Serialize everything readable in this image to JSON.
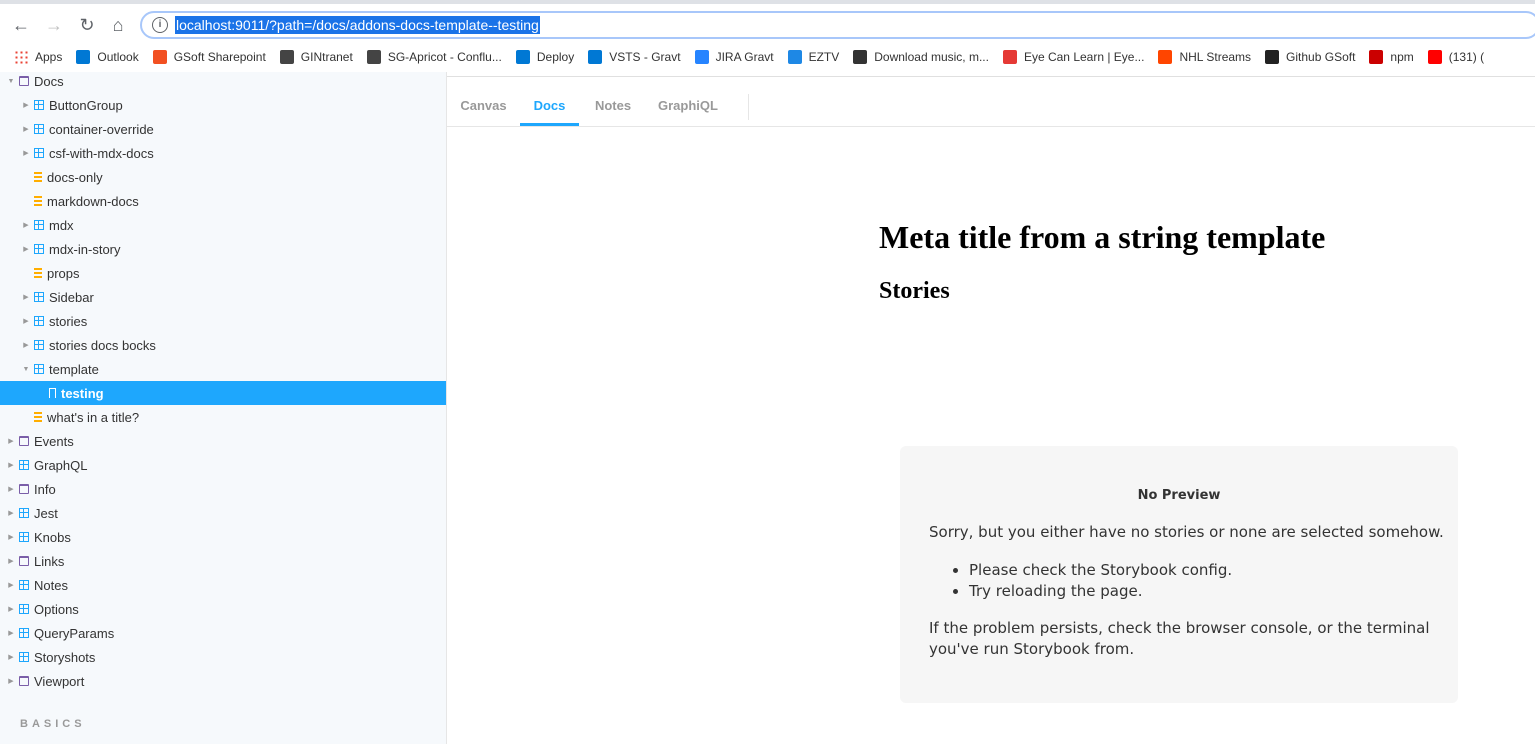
{
  "browser": {
    "url": "localhost:9011/?path=/docs/addons-docs-template--testing",
    "bookmarks": [
      {
        "label": "Apps",
        "icon": "apps-grid-icon",
        "color": "#ea4335"
      },
      {
        "label": "Outlook",
        "icon": "outlook-icon",
        "color": "#0078d4"
      },
      {
        "label": "GSoft Sharepoint",
        "icon": "windows-icon",
        "color": "#f25022"
      },
      {
        "label": "GINtranet",
        "icon": "g-icon",
        "color": "#444444"
      },
      {
        "label": "SG-Apricot - Conflu...",
        "icon": "g-icon",
        "color": "#444444"
      },
      {
        "label": "Deploy",
        "icon": "vsts-icon",
        "color": "#0078d4"
      },
      {
        "label": "VSTS - Gravt",
        "icon": "vsts-icon",
        "color": "#0078d4"
      },
      {
        "label": "JIRA Gravt",
        "icon": "jira-icon",
        "color": "#2684ff"
      },
      {
        "label": "EZTV",
        "icon": "eztv-icon",
        "color": "#1e88e5"
      },
      {
        "label": "Download music, m...",
        "icon": "download-icon",
        "color": "#333333"
      },
      {
        "label": "Eye Can Learn | Eye...",
        "icon": "ladybug-icon",
        "color": "#e53935"
      },
      {
        "label": "NHL Streams",
        "icon": "reddit-icon",
        "color": "#ff4500"
      },
      {
        "label": "Github GSoft",
        "icon": "github-icon",
        "color": "#222222"
      },
      {
        "label": "npm",
        "icon": "npm-icon",
        "color": "#cb0000"
      },
      {
        "label": "(131) (",
        "icon": "youtube-icon",
        "color": "#ff0000"
      }
    ]
  },
  "sidebar": {
    "items": [
      {
        "label": "Docs",
        "icon": "folder-icon",
        "depth": 0,
        "expanded": true
      },
      {
        "label": "ButtonGroup",
        "icon": "component-icon",
        "depth": 1,
        "expanded": false
      },
      {
        "label": "container-override",
        "icon": "component-icon",
        "depth": 1,
        "expanded": false
      },
      {
        "label": "csf-with-mdx-docs",
        "icon": "component-icon",
        "depth": 1,
        "expanded": false
      },
      {
        "label": "docs-only",
        "icon": "document-icon",
        "depth": 1
      },
      {
        "label": "markdown-docs",
        "icon": "document-icon",
        "depth": 1
      },
      {
        "label": "mdx",
        "icon": "component-icon",
        "depth": 1,
        "expanded": false
      },
      {
        "label": "mdx-in-story",
        "icon": "component-icon",
        "depth": 1,
        "expanded": false
      },
      {
        "label": "props",
        "icon": "document-icon",
        "depth": 1
      },
      {
        "label": "Sidebar",
        "icon": "component-icon",
        "depth": 1,
        "expanded": false
      },
      {
        "label": "stories",
        "icon": "component-icon",
        "depth": 1,
        "expanded": false
      },
      {
        "label": "stories docs bocks",
        "icon": "component-icon",
        "depth": 1,
        "expanded": false
      },
      {
        "label": "template",
        "icon": "component-icon",
        "depth": 1,
        "expanded": true
      },
      {
        "label": "testing",
        "icon": "bookmark-icon",
        "depth": 2,
        "selected": true
      },
      {
        "label": "what's in a title?",
        "icon": "document-icon",
        "depth": 1
      },
      {
        "label": "Events",
        "icon": "folder-icon",
        "depth": 0,
        "expanded": false
      },
      {
        "label": "GraphQL",
        "icon": "component-icon",
        "depth": 0,
        "expanded": false
      },
      {
        "label": "Info",
        "icon": "folder-icon",
        "depth": 0,
        "expanded": false
      },
      {
        "label": "Jest",
        "icon": "component-icon",
        "depth": 0,
        "expanded": false
      },
      {
        "label": "Knobs",
        "icon": "component-icon",
        "depth": 0,
        "expanded": false
      },
      {
        "label": "Links",
        "icon": "folder-icon",
        "depth": 0,
        "expanded": false
      },
      {
        "label": "Notes",
        "icon": "component-icon",
        "depth": 0,
        "expanded": false
      },
      {
        "label": "Options",
        "icon": "component-icon",
        "depth": 0,
        "expanded": false
      },
      {
        "label": "QueryParams",
        "icon": "component-icon",
        "depth": 0,
        "expanded": false
      },
      {
        "label": "Storyshots",
        "icon": "component-icon",
        "depth": 0,
        "expanded": false
      },
      {
        "label": "Viewport",
        "icon": "folder-icon",
        "depth": 0,
        "expanded": false
      }
    ],
    "section_label": "BASICS"
  },
  "tabs": [
    {
      "label": "Canvas",
      "active": false
    },
    {
      "label": "Docs",
      "active": true
    },
    {
      "label": "Notes",
      "active": false
    },
    {
      "label": "GraphiQL",
      "active": false
    }
  ],
  "doc": {
    "title": "Meta title from a string template",
    "subtitle": "Stories"
  },
  "no_preview": {
    "title": "No Preview",
    "message": "Sorry, but you either have no stories or none are selected somehow.",
    "tips": [
      "Please check the Storybook config.",
      "Try reloading the page."
    ],
    "footer": "If the problem persists, check the browser console, or the terminal you've run Storybook from."
  },
  "colors": {
    "accent": "#1ea7fd",
    "sidebar_bg": "#f6f9fc"
  }
}
